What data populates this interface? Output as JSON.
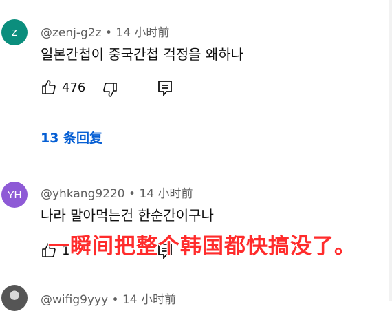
{
  "comments": [
    {
      "avatar": {
        "initials": "z",
        "color": "#0b8e7d"
      },
      "username": "@zenj-g2z",
      "time": "14 小时前",
      "text": "일본간첩이 중국간첩 걱정을 왜하나",
      "likes": "476",
      "replies_label": "13 条回复"
    },
    {
      "avatar": {
        "initials": "YH",
        "color": "#8e5ad6"
      },
      "username": "@yhkang9220",
      "time": "14 小时前",
      "text": "나라 말아먹는건 한순간이구나",
      "likes": "1"
    },
    {
      "username": "@wifig9yyy",
      "time": "14 小时前"
    }
  ],
  "overlay_caption": "一瞬间把整个韩国都快搞没了。",
  "meta_separator": "•",
  "icons": {
    "like": "thumbs-up-icon",
    "dislike": "thumbs-down-icon",
    "reply": "reply-comment-icon"
  }
}
